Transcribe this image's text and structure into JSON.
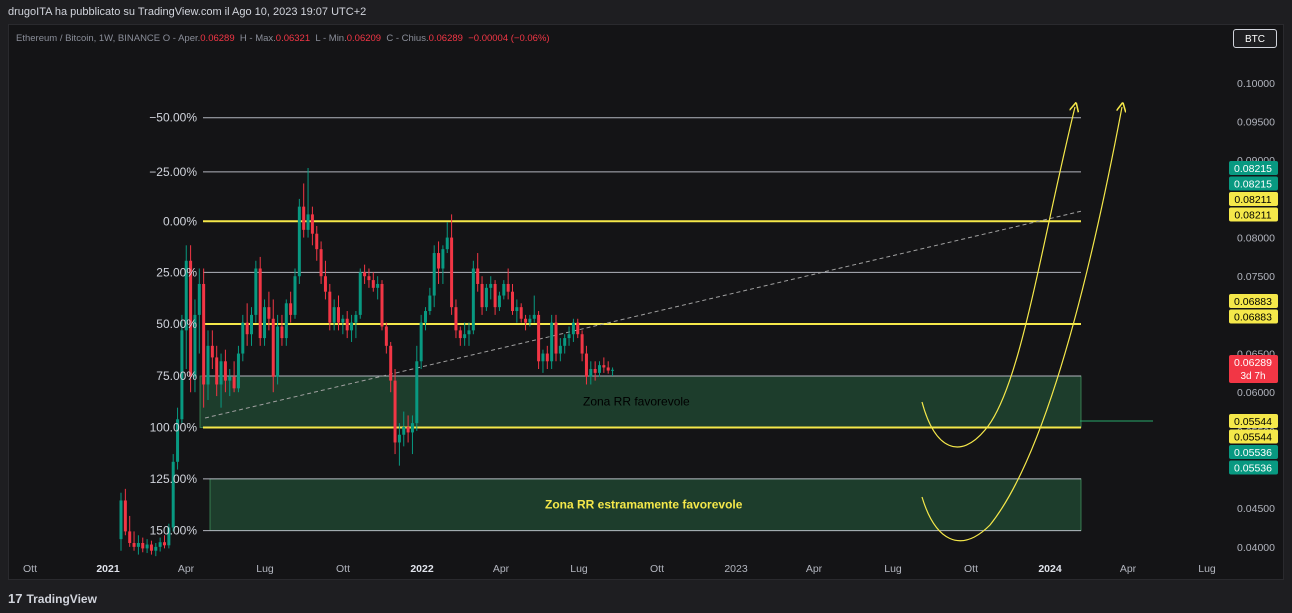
{
  "header": {
    "published_text": "drugoITA ha pubblicato su TradingView.com il Ago 10, 2023 19:07 UTC+2"
  },
  "legend": {
    "symbol_text": "Ethereum / Bitcoin, 1W, BINANCE  O - Aper.",
    "open": "0.06289",
    "high_label": "H - Max.",
    "high": "0.06321",
    "low_label": "L - Min.",
    "low": "0.06209",
    "close_label": "C - Chius.",
    "close": "0.06289",
    "change": "−0.00004 (−0.06%)"
  },
  "currency_button": "BTC",
  "footer": {
    "logo_mark": "17",
    "logo_text": "TradingView"
  },
  "colors": {
    "up": "#089981",
    "down": "#f23645",
    "fib_yellow": "#f5e84a",
    "fib_gray": "#b2b5be",
    "zone_green": "#2a5d3c",
    "text": "#d1d4dc"
  },
  "chart_data": {
    "type": "candlestick",
    "price_axis": {
      "ticks": [
        "0.10000",
        "0.09500",
        "0.09000",
        "0.08500",
        "0.08000",
        "0.07500",
        "0.07000",
        "0.06500",
        "0.06000",
        "0.05500",
        "0.05000",
        "0.04500",
        "0.04000"
      ],
      "tick_values": [
        0.1,
        0.095,
        0.09,
        0.085,
        0.08,
        0.075,
        0.07,
        0.065,
        0.06,
        0.055,
        0.05,
        0.045,
        0.04
      ],
      "range": [
        0.0383,
        0.104
      ]
    },
    "time_axis": {
      "labels": [
        "Ott",
        "2021",
        "Apr",
        "Lug",
        "Ott",
        "2022",
        "Apr",
        "Lug",
        "Ott",
        "2023",
        "Apr",
        "Lug",
        "Ott",
        "2024",
        "Apr",
        "Lug"
      ],
      "bold": [
        "2021",
        "2022",
        "2024"
      ]
    },
    "fib_levels": [
      {
        "label": "−50.00%",
        "price": 0.0955,
        "color": "gray"
      },
      {
        "label": "−25.00%",
        "price": 0.0885,
        "color": "gray"
      },
      {
        "label": "0.00%",
        "price": 0.08211,
        "color": "yellow"
      },
      {
        "label": "25.00%",
        "price": 0.0755,
        "color": "gray"
      },
      {
        "label": "50.00%",
        "price": 0.06883,
        "color": "yellow"
      },
      {
        "label": "75.00%",
        "price": 0.0621,
        "color": "gray"
      },
      {
        "label": "100.00%",
        "price": 0.05544,
        "color": "yellow"
      },
      {
        "label": "125.00%",
        "price": 0.0488,
        "color": "gray"
      },
      {
        "label": "150.00%",
        "price": 0.0421,
        "color": "gray"
      }
    ],
    "zones": [
      {
        "label": "Zona RR favorevole",
        "from": 0.05544,
        "to": 0.0621,
        "label_color": "#000000"
      },
      {
        "label": "Zona RR estramamente favorevole",
        "from": 0.0421,
        "to": 0.0488,
        "label_color": "#f5e84a"
      }
    ],
    "price_labels": [
      {
        "text": "0.08215",
        "price": 0.08215,
        "bg": "#089981",
        "fg": "#ffffff",
        "row": 0
      },
      {
        "text": "0.08215",
        "price": 0.08215,
        "bg": "#089981",
        "fg": "#ffffff",
        "row": 1
      },
      {
        "text": "0.08211",
        "price": 0.08211,
        "bg": "#f5e84a",
        "fg": "#000000",
        "row": 2
      },
      {
        "text": "0.08211",
        "price": 0.08211,
        "bg": "#f5e84a",
        "fg": "#000000",
        "row": 3
      },
      {
        "text": "0.06883",
        "price": 0.06883,
        "bg": "#f5e84a",
        "fg": "#000000",
        "row": 0
      },
      {
        "text": "0.06883",
        "price": 0.06883,
        "bg": "#f5e84a",
        "fg": "#000000",
        "row": 1
      },
      {
        "text": "0.06289",
        "price": 0.06289,
        "bg": "#f23645",
        "fg": "#ffffff",
        "row": 0,
        "sub": "3d 7h"
      },
      {
        "text": "0.05544",
        "price": 0.05544,
        "bg": "#f5e84a",
        "fg": "#000000",
        "row": 0
      },
      {
        "text": "0.05544",
        "price": 0.05544,
        "bg": "#f5e84a",
        "fg": "#000000",
        "row": 1
      },
      {
        "text": "0.05536",
        "price": 0.05536,
        "bg": "#089981",
        "fg": "#ffffff",
        "row": 2
      },
      {
        "text": "0.05536",
        "price": 0.05536,
        "bg": "#089981",
        "fg": "#ffffff",
        "row": 3
      }
    ],
    "candles": [
      [
        0.041,
        0.047,
        0.0395,
        0.046
      ],
      [
        0.046,
        0.0475,
        0.0415,
        0.042
      ],
      [
        0.042,
        0.044,
        0.04,
        0.0405
      ],
      [
        0.0405,
        0.042,
        0.0395,
        0.04
      ],
      [
        0.04,
        0.0415,
        0.039,
        0.0405
      ],
      [
        0.0405,
        0.0412,
        0.0393,
        0.0398
      ],
      [
        0.0398,
        0.041,
        0.0392,
        0.0403
      ],
      [
        0.0403,
        0.0408,
        0.039,
        0.0395
      ],
      [
        0.0395,
        0.0405,
        0.0388,
        0.04
      ],
      [
        0.04,
        0.0412,
        0.0394,
        0.0406
      ],
      [
        0.0406,
        0.0415,
        0.0398,
        0.0402
      ],
      [
        0.0402,
        0.043,
        0.0398,
        0.0425
      ],
      [
        0.0425,
        0.052,
        0.042,
        0.051
      ],
      [
        0.051,
        0.058,
        0.05,
        0.0565
      ],
      [
        0.0565,
        0.07,
        0.056,
        0.068
      ],
      [
        0.068,
        0.079,
        0.063,
        0.077
      ],
      [
        0.077,
        0.079,
        0.06,
        0.062
      ],
      [
        0.062,
        0.072,
        0.06,
        0.07
      ],
      [
        0.07,
        0.076,
        0.065,
        0.074
      ],
      [
        0.074,
        0.076,
        0.058,
        0.061
      ],
      [
        0.061,
        0.068,
        0.059,
        0.066
      ],
      [
        0.066,
        0.068,
        0.063,
        0.0645
      ],
      [
        0.0645,
        0.066,
        0.0595,
        0.061
      ],
      [
        0.061,
        0.065,
        0.058,
        0.064
      ],
      [
        0.064,
        0.0655,
        0.06,
        0.0615
      ],
      [
        0.0615,
        0.063,
        0.0595,
        0.062
      ],
      [
        0.062,
        0.064,
        0.06,
        0.0605
      ],
      [
        0.0605,
        0.066,
        0.06,
        0.065
      ],
      [
        0.065,
        0.07,
        0.064,
        0.069
      ],
      [
        0.069,
        0.0715,
        0.066,
        0.0675
      ],
      [
        0.0675,
        0.071,
        0.066,
        0.07
      ],
      [
        0.07,
        0.077,
        0.069,
        0.076
      ],
      [
        0.076,
        0.0775,
        0.066,
        0.067
      ],
      [
        0.067,
        0.072,
        0.066,
        0.071
      ],
      [
        0.071,
        0.073,
        0.068,
        0.0695
      ],
      [
        0.0695,
        0.072,
        0.06,
        0.062
      ],
      [
        0.062,
        0.07,
        0.061,
        0.0685
      ],
      [
        0.0685,
        0.07,
        0.066,
        0.067
      ],
      [
        0.067,
        0.072,
        0.066,
        0.0715
      ],
      [
        0.0715,
        0.073,
        0.069,
        0.07
      ],
      [
        0.07,
        0.076,
        0.0695,
        0.075
      ],
      [
        0.075,
        0.085,
        0.074,
        0.084
      ],
      [
        0.084,
        0.087,
        0.08,
        0.081
      ],
      [
        0.081,
        0.089,
        0.08,
        0.083
      ],
      [
        0.083,
        0.084,
        0.079,
        0.0805
      ],
      [
        0.0805,
        0.0815,
        0.077,
        0.0785
      ],
      [
        0.0785,
        0.0795,
        0.074,
        0.075
      ],
      [
        0.075,
        0.077,
        0.072,
        0.073
      ],
      [
        0.073,
        0.074,
        0.068,
        0.069
      ],
      [
        0.069,
        0.072,
        0.068,
        0.071
      ],
      [
        0.071,
        0.0725,
        0.068,
        0.069
      ],
      [
        0.069,
        0.07,
        0.0675,
        0.0695
      ],
      [
        0.0695,
        0.0705,
        0.067,
        0.068
      ],
      [
        0.068,
        0.07,
        0.0665,
        0.069
      ],
      [
        0.069,
        0.0705,
        0.067,
        0.07
      ],
      [
        0.07,
        0.076,
        0.0695,
        0.0755
      ],
      [
        0.0755,
        0.0765,
        0.074,
        0.075
      ],
      [
        0.075,
        0.076,
        0.0735,
        0.0745
      ],
      [
        0.0745,
        0.0755,
        0.073,
        0.0735
      ],
      [
        0.0735,
        0.075,
        0.072,
        0.074
      ],
      [
        0.074,
        0.0745,
        0.068,
        0.0685
      ],
      [
        0.0685,
        0.069,
        0.065,
        0.066
      ],
      [
        0.066,
        0.0665,
        0.06,
        0.0615
      ],
      [
        0.0615,
        0.063,
        0.052,
        0.0535
      ],
      [
        0.0535,
        0.056,
        0.0505,
        0.0545
      ],
      [
        0.0545,
        0.0575,
        0.053,
        0.0555
      ],
      [
        0.0555,
        0.057,
        0.0535,
        0.0548
      ],
      [
        0.0548,
        0.057,
        0.052,
        0.056
      ],
      [
        0.056,
        0.066,
        0.055,
        0.064
      ],
      [
        0.064,
        0.07,
        0.063,
        0.069
      ],
      [
        0.069,
        0.071,
        0.068,
        0.0705
      ],
      [
        0.0705,
        0.0735,
        0.07,
        0.0725
      ],
      [
        0.0725,
        0.079,
        0.071,
        0.078
      ],
      [
        0.078,
        0.0795,
        0.074,
        0.076
      ],
      [
        0.076,
        0.079,
        0.074,
        0.0785
      ],
      [
        0.0785,
        0.082,
        0.078,
        0.08
      ],
      [
        0.08,
        0.083,
        0.07,
        0.071
      ],
      [
        0.071,
        0.072,
        0.067,
        0.068
      ],
      [
        0.068,
        0.0685,
        0.066,
        0.067
      ],
      [
        0.067,
        0.069,
        0.066,
        0.0675
      ],
      [
        0.0675,
        0.069,
        0.066,
        0.068
      ],
      [
        0.068,
        0.077,
        0.0675,
        0.076
      ],
      [
        0.076,
        0.078,
        0.073,
        0.074
      ],
      [
        0.074,
        0.075,
        0.07,
        0.071
      ],
      [
        0.071,
        0.074,
        0.0705,
        0.0735
      ],
      [
        0.0735,
        0.075,
        0.072,
        0.074
      ],
      [
        0.074,
        0.0745,
        0.07,
        0.071
      ],
      [
        0.071,
        0.073,
        0.0705,
        0.0725
      ],
      [
        0.0725,
        0.0745,
        0.072,
        0.074
      ],
      [
        0.074,
        0.076,
        0.072,
        0.073
      ],
      [
        0.073,
        0.074,
        0.07,
        0.0705
      ],
      [
        0.0705,
        0.072,
        0.069,
        0.071
      ],
      [
        0.071,
        0.0715,
        0.069,
        0.0695
      ],
      [
        0.0695,
        0.07,
        0.068,
        0.069
      ],
      [
        0.069,
        0.07,
        0.0685,
        0.0695
      ],
      [
        0.0695,
        0.0725,
        0.069,
        0.07
      ],
      [
        0.07,
        0.0705,
        0.063,
        0.064
      ],
      [
        0.064,
        0.0655,
        0.0625,
        0.065
      ],
      [
        0.065,
        0.066,
        0.063,
        0.064
      ],
      [
        0.064,
        0.07,
        0.063,
        0.069
      ],
      [
        0.069,
        0.07,
        0.064,
        0.065
      ],
      [
        0.065,
        0.067,
        0.064,
        0.066
      ],
      [
        0.066,
        0.0675,
        0.065,
        0.067
      ],
      [
        0.067,
        0.0685,
        0.066,
        0.0675
      ],
      [
        0.0675,
        0.0695,
        0.0665,
        0.069
      ],
      [
        0.069,
        0.0695,
        0.067,
        0.0675
      ],
      [
        0.0675,
        0.068,
        0.064,
        0.065
      ],
      [
        0.065,
        0.066,
        0.061,
        0.062
      ],
      [
        0.062,
        0.064,
        0.061,
        0.063
      ],
      [
        0.063,
        0.064,
        0.0615,
        0.0625
      ],
      [
        0.0625,
        0.064,
        0.062,
        0.0635
      ],
      [
        0.0635,
        0.0645,
        0.0625,
        0.0632
      ],
      [
        0.0632,
        0.064,
        0.0624,
        0.0628
      ],
      [
        0.0628,
        0.0632,
        0.0621,
        0.0629
      ]
    ]
  }
}
